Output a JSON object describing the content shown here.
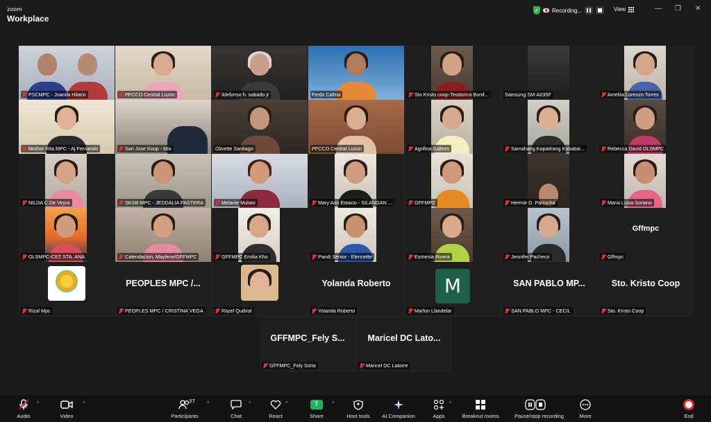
{
  "app": {
    "brand_small": "zoom",
    "brand": "Workplace"
  },
  "topbar": {
    "recording_label": "Recording...",
    "view_label": "View",
    "window_controls": [
      "—",
      "❐",
      "✕"
    ]
  },
  "colors": {
    "active_speaker": "#27c46b",
    "muted": "#e03030",
    "share": "#1fb45e",
    "end": "#e02828"
  },
  "participants": [
    "PSCMPC - Juanita Hilario",
    "PFCCO Central Luzon",
    "ildefonso h. sabado jr",
    "Ferdz Calma",
    "Sto Kristo coop-Teodorica Bonif...",
    "Samsung SM-A035F",
    "Amelita Lorenzo Torres",
    "Mother Rita MPC - Aj Fernando",
    "San Jose Koop - Mia",
    "Olivette Santiago",
    "PFCCO Central Luzon",
    "Agrifina Gabres",
    "Samahang Kapatirang Kababai...",
    "Rebecca David OLSMPC",
    "NILDA C.De Veyra",
    "SKSB-MPC - JEDDALIA PASTERA",
    "Melanie Mulato",
    "Mary Ann Estacio - SILANGAN ...",
    "GFFMPC",
    "Hermie D. Parrocha",
    "Maria Luisa Soriano",
    "OLSMPC-CEZ STA. ANA",
    "Calendacion, Maylene/GFFMPC",
    "GFFMPC Emilia Kho",
    "Pandi Senior - Elennette",
    "Esmenia Rivera",
    "Jennifer Pacheco",
    "Gffmpc",
    "Rizal Mpc",
    "PEOPLES MPC / CRISTINA VEGA",
    "Razel Quibral",
    "Yolanda Roberto",
    "Marlon Llandelar",
    "SAN PABLO MPC - CECIL",
    "Sto. Kristo Coop",
    "GFFMPC_Fely Soria",
    "Maricel DC Latorre"
  ],
  "name_tiles": {
    "gffmpc": "Gffmpc",
    "peoples": "PEOPLES MPC /...",
    "yolanda": "Yolanda Roberto",
    "marlon_initial": "M",
    "sanpablo": "SAN PABLO MP...",
    "stokristo": "Sto. Kristo Coop",
    "fely": "GFFMPC_Fely S...",
    "maricel": "Maricel DC Lato..."
  },
  "toolbar": {
    "audio": "Audio",
    "video": "Video",
    "participants": "Participants",
    "participants_count": "37",
    "chat": "Chat",
    "react": "React",
    "share": "Share",
    "host_tools": "Host tools",
    "ai_companion": "AI Companion",
    "apps": "Apps",
    "breakout_rooms": "Breakout rooms",
    "pause_stop_recording": "Pause/stop recording",
    "more": "More",
    "end": "End"
  }
}
